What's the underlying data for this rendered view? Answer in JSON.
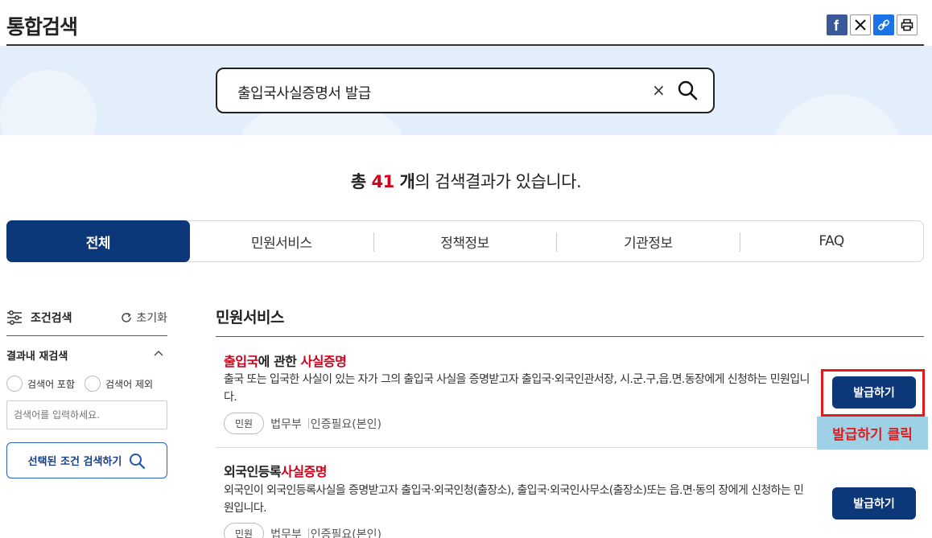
{
  "header": {
    "title": "통합검색"
  },
  "share_icons": [
    "facebook-icon",
    "x-icon",
    "link-icon",
    "print-icon"
  ],
  "search": {
    "value": "출입국사실증명서 발급",
    "clear_label": "×"
  },
  "result": {
    "prefix": "총 ",
    "count": "41",
    "unit": " 개",
    "suffix": "의 검색결과가 있습니다."
  },
  "tabs": [
    {
      "label": "전체",
      "active": true
    },
    {
      "label": "민원서비스",
      "active": false
    },
    {
      "label": "정책정보",
      "active": false
    },
    {
      "label": "기관정보",
      "active": false
    },
    {
      "label": "FAQ",
      "active": false
    }
  ],
  "filter": {
    "title": "조건검색",
    "reset_label": "초기화",
    "refine_title": "결과내 재검색",
    "include_label": "검색어 포함",
    "exclude_label": "검색어 제외",
    "input_placeholder": "검색어를 입력하세요.",
    "button_label": "선택된 조건 검색하기"
  },
  "section": {
    "title": "민원서비스"
  },
  "items": [
    {
      "title_parts": [
        "출입국",
        "에 관한 ",
        "사실증명"
      ],
      "description": "출국 또는 입국한 사실이 있는 자가 그의 출입국 사실을 증명받고자 출입국·외국인관서장, 시.군.구,읍.면.동장에게 신청하는 민원입니다.",
      "badge": "민원",
      "agency": "법무부",
      "auth": "인증필요(본인)",
      "button_label": "발급하기"
    },
    {
      "title_parts": [
        "외국인등록",
        "사실증명"
      ],
      "description": "외국인이 외국인등록사실을 증명받고자 출입국·외국인청(출장소), 출입국·외국인사무소(출장소)또는 읍.면·동의 장에게 신청하는 민원입니다.",
      "badge": "민원",
      "agency": "법무부",
      "auth": "인증필요(본인)",
      "button_label": "발급하기"
    }
  ],
  "annotation": {
    "label": "발급하기 클릭"
  },
  "colors": {
    "primary": "#0c3778",
    "highlight": "#d0021b",
    "band": "#e3eefb",
    "annotation_bg": "#9ed1e6"
  }
}
